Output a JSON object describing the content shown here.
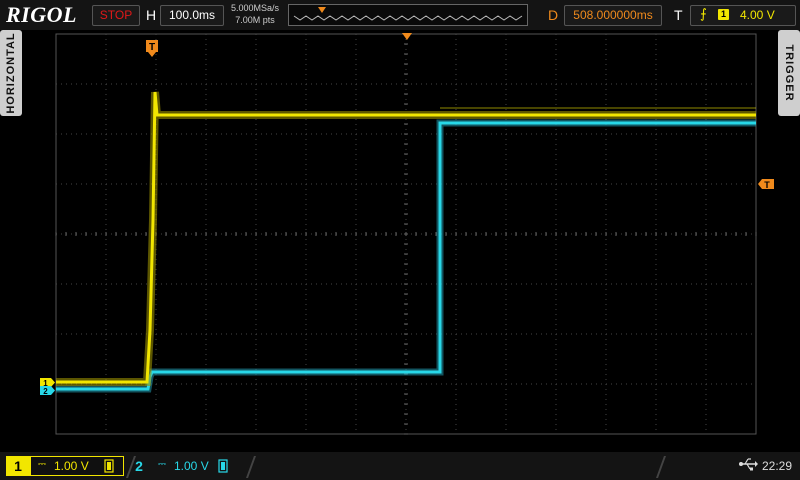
{
  "header": {
    "brand": "RIGOL",
    "run_state": "STOP",
    "horizontal_label": "H",
    "timebase": "100.0ms",
    "sample_rate": "5.000MSa/s",
    "memory_depth": "7.00M pts",
    "delay_label": "D",
    "delay": "508.000000ms",
    "trigger_label": "T",
    "trigger_edge_icon": "rising-edge-icon",
    "trigger_source": "1",
    "trigger_level": "4.00 V"
  },
  "side_tabs": {
    "left": "HORIZONTAL",
    "right": "TRIGGER"
  },
  "markers": {
    "trigger_pos": "T",
    "trigger_level": "T",
    "ch1": "1",
    "ch2": "2"
  },
  "channels": [
    {
      "number": "1",
      "coupling": "⎓",
      "scale": "1.00 V",
      "bw_icon": "bandwidth-limit-icon",
      "color": "#f2e600"
    },
    {
      "number": "2",
      "coupling": "⎓",
      "scale": "1.00 V",
      "bw_icon": "bandwidth-limit-icon",
      "color": "#28d8e8"
    }
  ],
  "status": {
    "usb_icon": "usb-icon",
    "clock": "22:29"
  },
  "colors": {
    "ch1": "#f2e600",
    "ch2": "#28d8e8",
    "accent": "#f08a1c",
    "stop": "#e01818"
  }
}
